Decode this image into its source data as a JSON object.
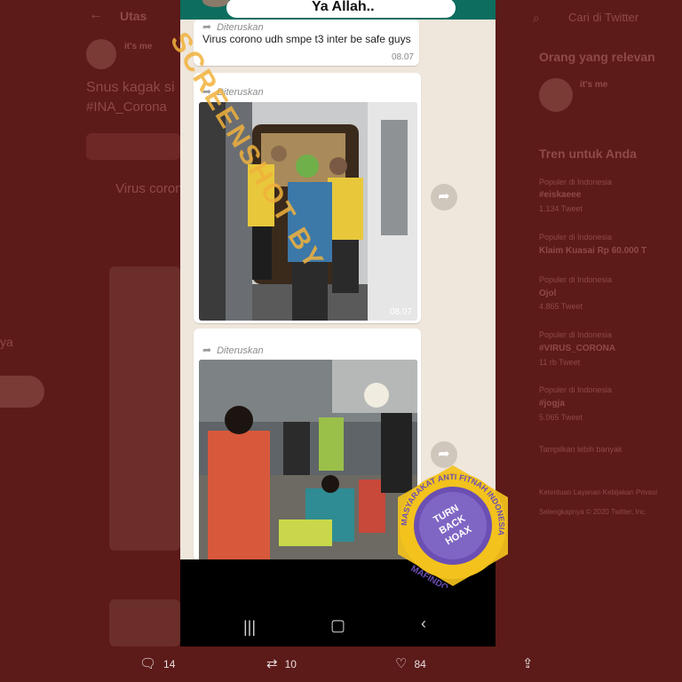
{
  "twitter": {
    "back_icon": "arrow-left-icon",
    "header_title": "Utas",
    "author_name": "it's me",
    "tweet_text_line1": "Snus kagak si",
    "tweet_text_line2": "#INA_Corona",
    "quoted_text": "Virus coron",
    "side_text": "ya",
    "search_placeholder": "Cari di Twitter",
    "relevant_title": "Orang yang relevan",
    "relevant_name": "it's me",
    "trends_title": "Tren untuk Anda",
    "trends": [
      {
        "context": "Populer di Indonesia",
        "name": "#eiskaeee",
        "count": "1.134 Tweet"
      },
      {
        "context": "Populer di Indonesia",
        "name": "Klaim Kuasai Rp 60.000 T",
        "count": ""
      },
      {
        "context": "Populer di Indonesia",
        "name": "Ojol",
        "count": "4.865 Tweet"
      },
      {
        "context": "Populer di Indonesia",
        "name": "#VIRUS_CORONA",
        "count": "11 rb Tweet"
      },
      {
        "context": "Populer di Indonesia",
        "name": "#jogja",
        "count": "5.065 Tweet"
      }
    ],
    "show_more": "Tampilkan lebih banyak",
    "footer_line1": "Ketentuan Layanan  Kebijakan Privasi",
    "footer_line2": "Selengkapnya  © 2020 Twitter, Inc."
  },
  "actions": {
    "reply_icon": "speech-bubble-icon",
    "reply_count": "14",
    "retweet_icon": "retweet-icon",
    "retweet_count": "10",
    "like_icon": "heart-icon",
    "like_count": "84",
    "share_icon": "share-icon"
  },
  "whatsapp": {
    "chat_title": "Ya Allah..",
    "messages": [
      {
        "forwarded_label": "Diteruskan",
        "text": "Virus corono udh smpe t3 inter be safe guys",
        "time": "08.07"
      },
      {
        "forwarded_label": "Diteruskan",
        "time": "08.07"
      },
      {
        "forwarded_label": "Diteruskan"
      }
    ],
    "share_button_icon": "forward-arrow-icon",
    "nav": {
      "recents_icon": "recents-icon",
      "home_icon": "home-icon",
      "back_icon": "back-chevron-icon"
    }
  },
  "watermark_text": "SCREENSHOT BY",
  "stamp": {
    "ring_text": "MASYARAKAT ANTI FITNAH INDONESIA",
    "city": "MAFINDO",
    "center_lines": [
      "TURN",
      "BACK",
      "HOAX"
    ]
  },
  "colors": {
    "background_tint": "#5c1a19",
    "whatsapp_header": "#0d6e5f",
    "watermark": "#f1b23c",
    "stamp_yellow": "#f3c21c",
    "stamp_purple": "#6b4fb3"
  }
}
